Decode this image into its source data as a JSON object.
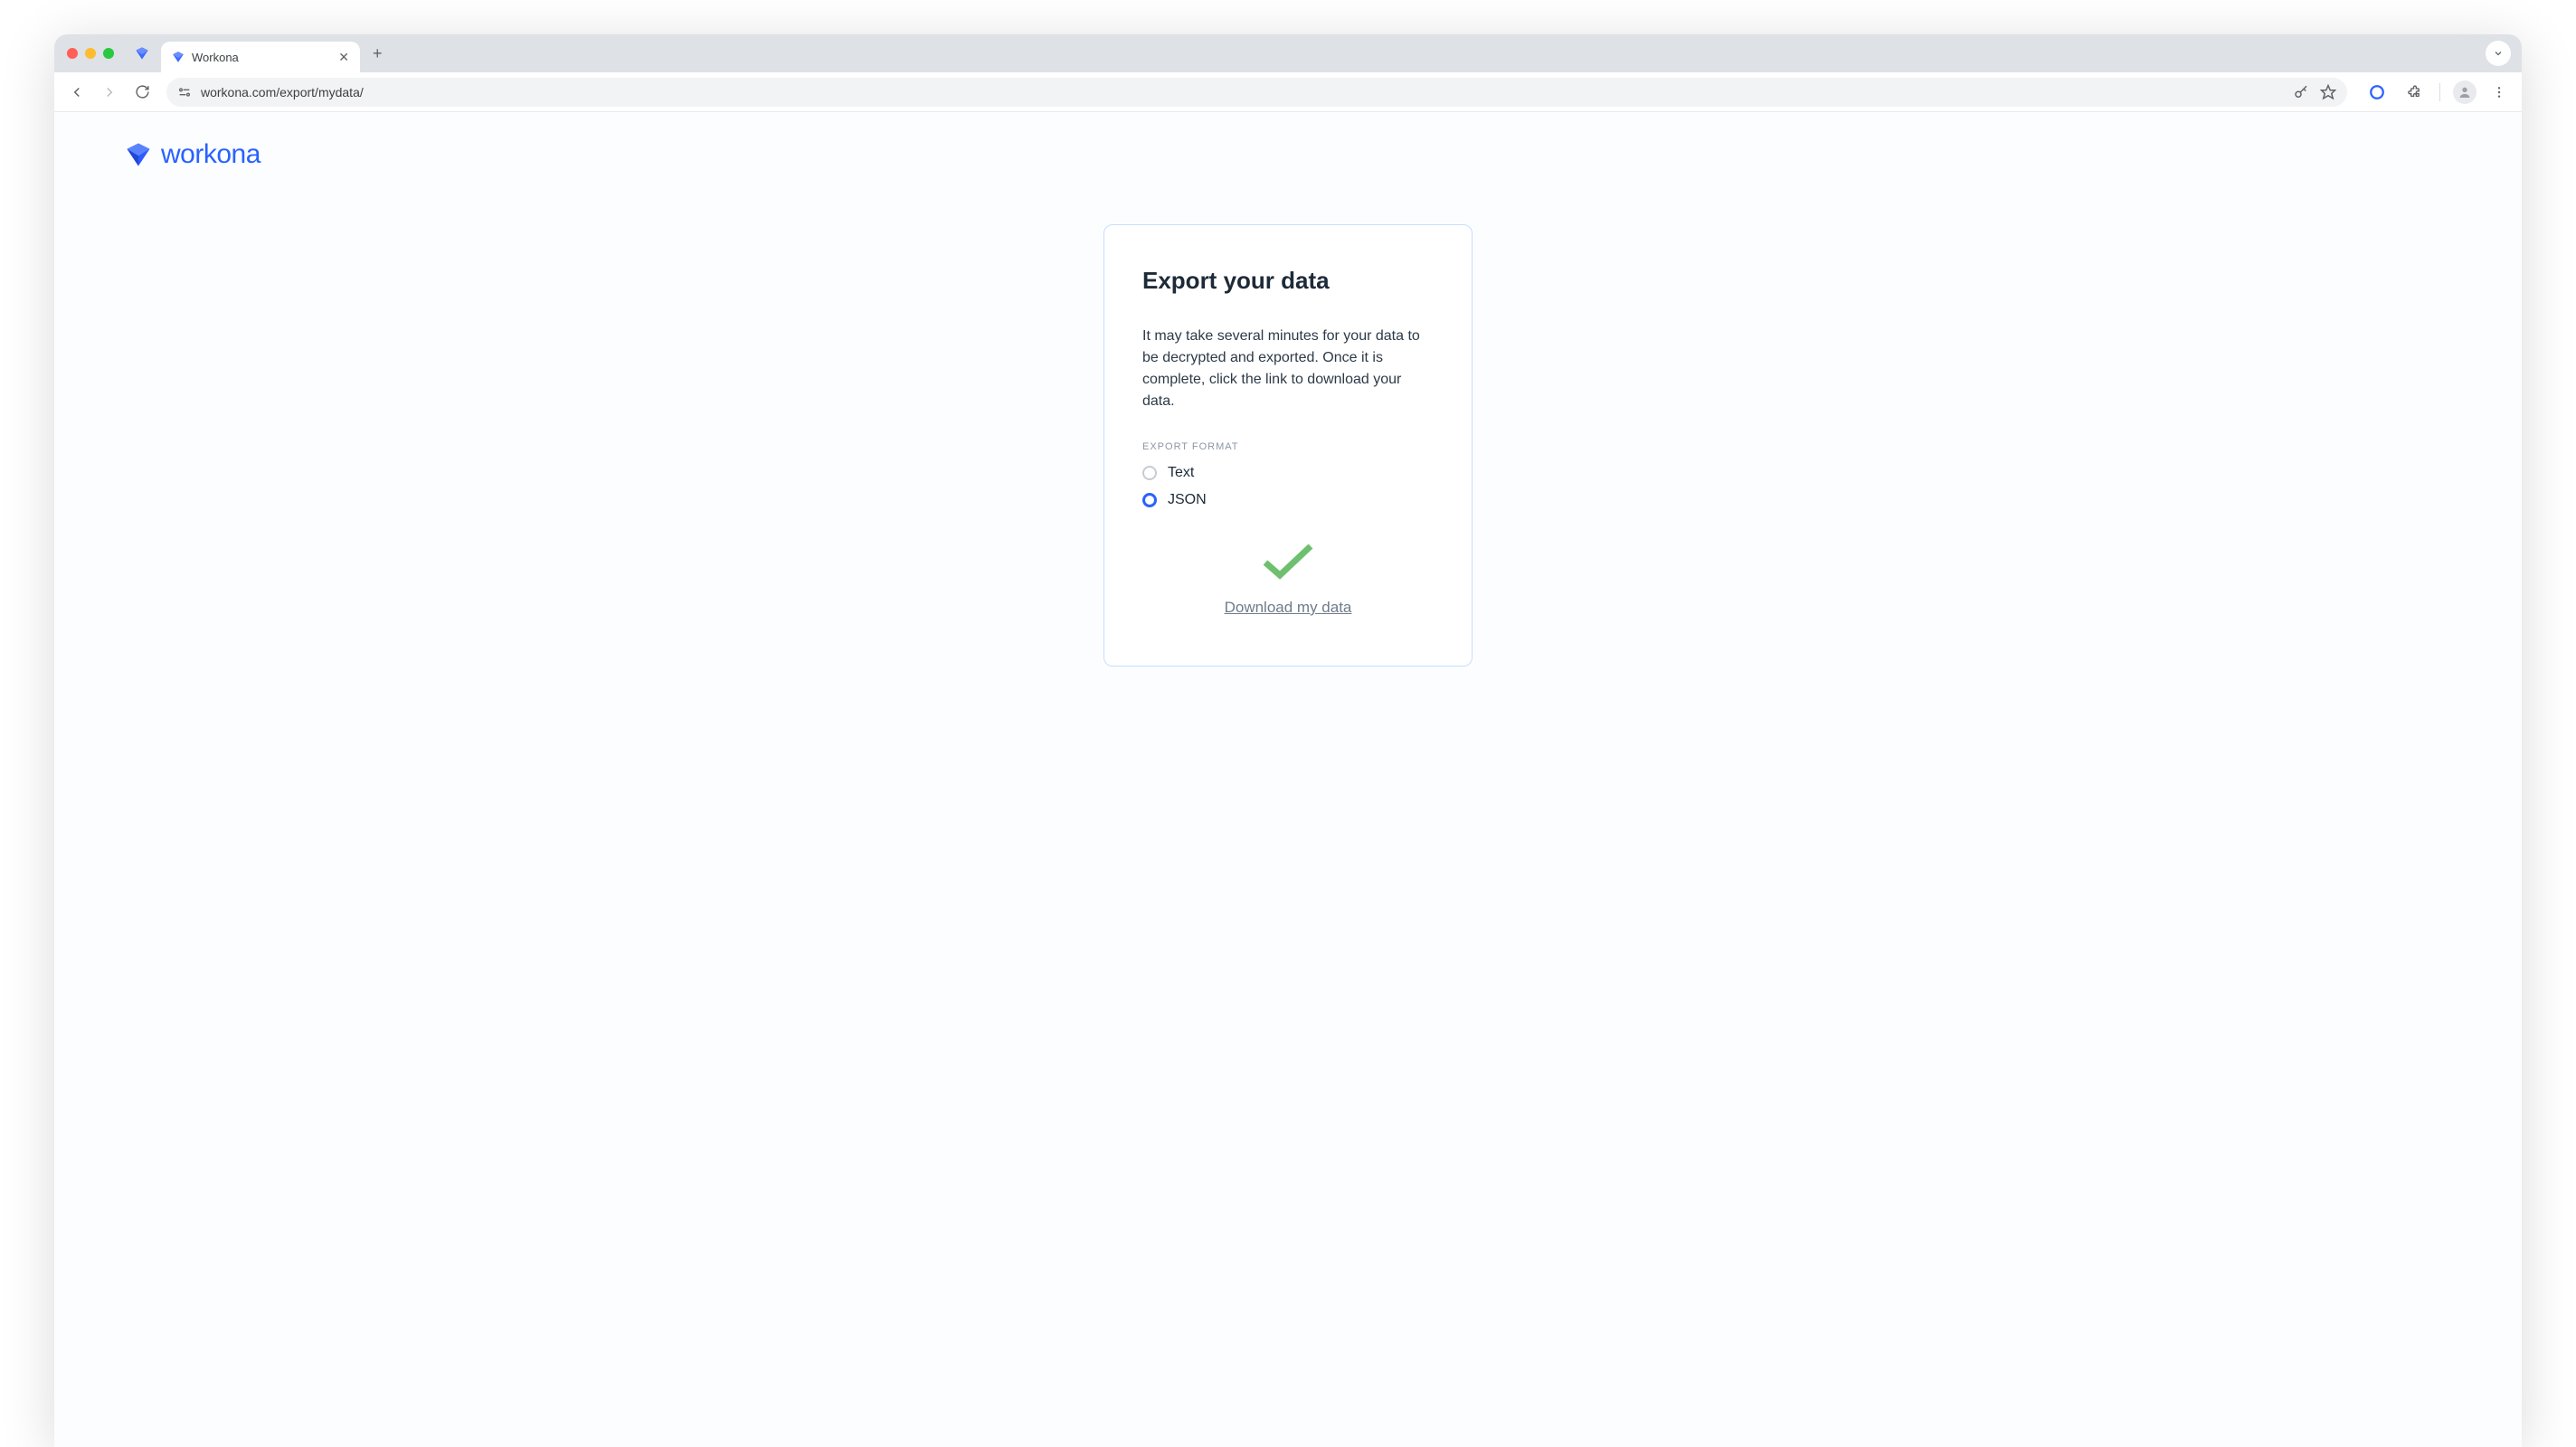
{
  "browser": {
    "tab_title": "Workona",
    "url": "workona.com/export/mydata/"
  },
  "brand": {
    "name": "workona"
  },
  "card": {
    "title": "Export your data",
    "description": "It may take several minutes for your data to be decrypted and exported. Once it is complete, click the link to download your data.",
    "format_label": "EXPORT FORMAT",
    "options": {
      "text": "Text",
      "json": "JSON"
    },
    "selected": "json",
    "download_link": "Download my data"
  },
  "colors": {
    "accent": "#2962ff",
    "success": "#6ebf6e"
  }
}
